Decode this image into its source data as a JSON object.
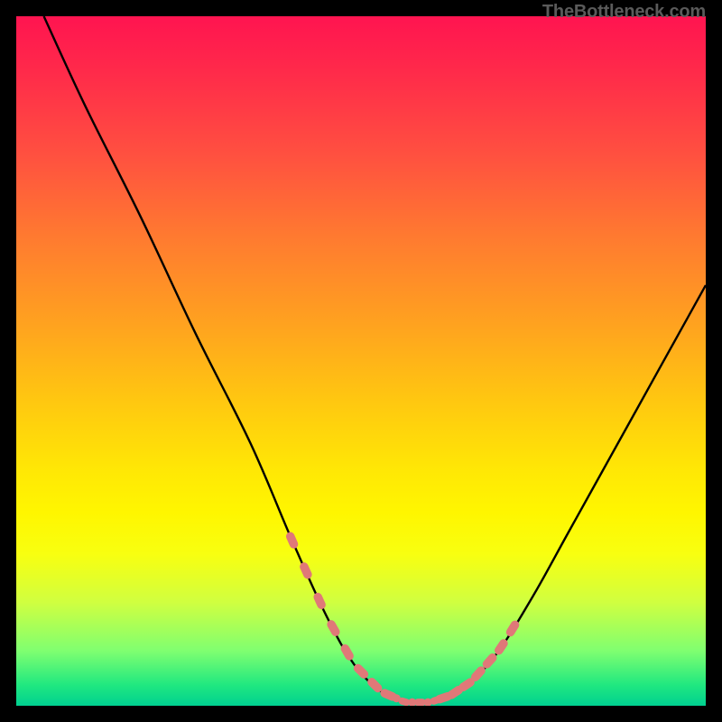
{
  "attribution": "TheBottleneck.com",
  "chart_data": {
    "type": "line",
    "title": "",
    "xlabel": "",
    "ylabel": "",
    "xlim": [
      0,
      100
    ],
    "ylim": [
      0,
      100
    ],
    "series": [
      {
        "name": "curve",
        "x": [
          4,
          10,
          18,
          26,
          34,
          40,
          45,
          49,
          53,
          56.5,
          60,
          63,
          66,
          70,
          75,
          80,
          85,
          90,
          95,
          100
        ],
        "y": [
          100,
          87,
          71,
          54,
          38,
          24,
          13,
          6,
          2,
          0.5,
          0.5,
          1.5,
          3.5,
          8,
          16,
          25,
          34,
          43,
          52,
          61
        ]
      }
    ],
    "colors": {
      "curve_stroke": "#000000",
      "marker_fill": "#e07878",
      "marker_stroke": "#e07878"
    },
    "markers": {
      "left_cluster_x_range": [
        40,
        54
      ],
      "right_cluster_x_range": [
        62,
        72
      ],
      "bottom_cluster_x_range": [
        54,
        62
      ]
    }
  }
}
